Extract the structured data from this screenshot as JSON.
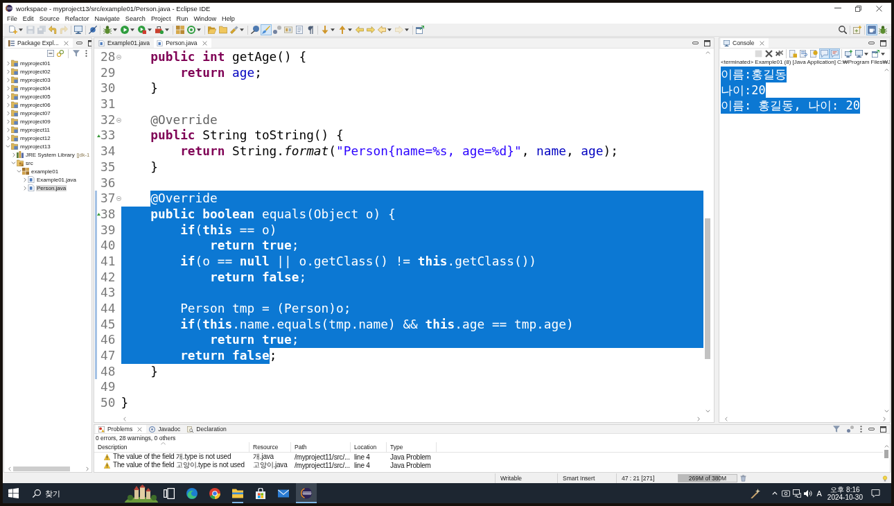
{
  "window": {
    "title": "workspace - myproject13/src/example01/Person.java - Eclipse IDE"
  },
  "menu": [
    "File",
    "Edit",
    "Source",
    "Refactor",
    "Navigate",
    "Search",
    "Project",
    "Run",
    "Window",
    "Help"
  ],
  "toolbar": [
    {
      "items": [
        {
          "kind": "new",
          "dropdown": true,
          "disabled": false,
          "pressed": false
        },
        {
          "kind": "save",
          "dropdown": false,
          "disabled": true,
          "pressed": false
        },
        {
          "kind": "saveall",
          "dropdown": false,
          "disabled": true,
          "pressed": false
        },
        {
          "kind": "undo",
          "dropdown": false,
          "disabled": false,
          "pressed": false
        },
        {
          "kind": "redo",
          "dropdown": false,
          "disabled": true,
          "pressed": false
        }
      ]
    },
    {
      "items": [
        {
          "kind": "terminal",
          "dropdown": false,
          "disabled": false,
          "pressed": false
        }
      ]
    },
    {
      "items": [
        {
          "kind": "skip",
          "dropdown": false,
          "disabled": false,
          "pressed": false
        }
      ]
    },
    {
      "items": [
        {
          "kind": "debug",
          "dropdown": true,
          "disabled": false,
          "pressed": false
        },
        {
          "kind": "run",
          "dropdown": true,
          "disabled": false,
          "pressed": false
        },
        {
          "kind": "coverage",
          "dropdown": true,
          "disabled": false,
          "pressed": false
        },
        {
          "kind": "tools",
          "dropdown": true,
          "disabled": false,
          "pressed": false
        }
      ]
    },
    {
      "items": [
        {
          "kind": "newpackage",
          "dropdown": false,
          "disabled": false,
          "pressed": false
        },
        {
          "kind": "newclass",
          "dropdown": true,
          "disabled": false,
          "pressed": false
        }
      ]
    },
    {
      "items": [
        {
          "kind": "opentype",
          "dropdown": false,
          "disabled": false,
          "pressed": false
        },
        {
          "kind": "openfolder",
          "dropdown": false,
          "disabled": false,
          "pressed": false
        },
        {
          "kind": "search",
          "dropdown": true,
          "disabled": false,
          "pressed": false
        }
      ]
    },
    {
      "items": [
        {
          "kind": "pin",
          "dropdown": false,
          "disabled": false,
          "pressed": false
        },
        {
          "kind": "mark",
          "dropdown": false,
          "disabled": false,
          "pressed": true
        },
        {
          "kind": "occurrences",
          "dropdown": false,
          "disabled": false,
          "pressed": false
        },
        {
          "kind": "blocks",
          "dropdown": false,
          "disabled": false,
          "pressed": false
        },
        {
          "kind": "doc",
          "dropdown": false,
          "disabled": false,
          "pressed": false
        },
        {
          "kind": "whitespace",
          "dropdown": false,
          "disabled": false,
          "pressed": false
        }
      ]
    },
    {
      "items": [
        {
          "kind": "nextann",
          "dropdown": true,
          "disabled": false,
          "pressed": false
        },
        {
          "kind": "prevann",
          "dropdown": true,
          "disabled": false,
          "pressed": false
        },
        {
          "kind": "lastedit",
          "dropdown": false,
          "disabled": false,
          "pressed": false
        },
        {
          "kind": "nextedit",
          "dropdown": false,
          "disabled": false,
          "pressed": false
        },
        {
          "kind": "back",
          "dropdown": true,
          "disabled": false,
          "pressed": false
        },
        {
          "kind": "forward",
          "dropdown": true,
          "disabled": true,
          "pressed": false
        }
      ]
    },
    {
      "items": [
        {
          "kind": "openview",
          "dropdown": false,
          "disabled": false,
          "pressed": false
        }
      ]
    }
  ],
  "perspectives": [
    {
      "items": [
        {
          "kind": "find",
          "dropdown": false,
          "disabled": false,
          "pressed": false
        }
      ]
    },
    {
      "items": [
        {
          "kind": "openperspective",
          "dropdown": false,
          "disabled": false,
          "pressed": false
        }
      ]
    },
    {
      "items": [
        {
          "kind": "javaperspective",
          "dropdown": false,
          "disabled": false,
          "pressed": true
        },
        {
          "kind": "debugperspective",
          "dropdown": false,
          "disabled": false,
          "pressed": false
        }
      ]
    }
  ],
  "package_explorer": {
    "tab": {
      "label": "Package Expl...",
      "selected": true
    },
    "tree": [
      {
        "label": "myproject01",
        "kind": "project",
        "expanded": false,
        "selected": false
      },
      {
        "label": "myproject02",
        "kind": "project",
        "expanded": false,
        "selected": false
      },
      {
        "label": "myproject03",
        "kind": "project",
        "expanded": false,
        "selected": false
      },
      {
        "label": "myproject04",
        "kind": "project",
        "expanded": false,
        "selected": false
      },
      {
        "label": "myproject05",
        "kind": "project",
        "expanded": false,
        "selected": false
      },
      {
        "label": "myproject06",
        "kind": "project",
        "expanded": false,
        "selected": false
      },
      {
        "label": "myproject07",
        "kind": "project",
        "expanded": false,
        "selected": false
      },
      {
        "label": "myproject09",
        "kind": "project",
        "expanded": false,
        "selected": false
      },
      {
        "label": "myproject11",
        "kind": "project",
        "expanded": false,
        "selected": false
      },
      {
        "label": "myproject12",
        "kind": "project",
        "expanded": false,
        "selected": false
      },
      {
        "label": "myproject13",
        "kind": "project",
        "expanded": true,
        "selected": false,
        "children": [
          {
            "label": "JRE System Library",
            "detail": "[jdk-1",
            "kind": "library",
            "expanded": false,
            "selected": false
          },
          {
            "label": "src",
            "kind": "source",
            "expanded": true,
            "selected": false,
            "children": [
              {
                "label": "example01",
                "kind": "package",
                "expanded": true,
                "selected": false,
                "children": [
                  {
                    "label": "Example01.java",
                    "kind": "file",
                    "expanded": false,
                    "selected": false
                  },
                  {
                    "label": "Person.java",
                    "kind": "file",
                    "expanded": false,
                    "selected": true
                  }
                ]
              }
            ]
          }
        ]
      }
    ]
  },
  "editor": {
    "tabs": [
      {
        "label": "Example01.java",
        "selected": false
      },
      {
        "label": "Person.java",
        "selected": true
      }
    ],
    "lines": [
      {
        "number": "28",
        "fold": true,
        "override": false,
        "range": false,
        "eol_selected": false,
        "tokens": [
          {
            "text": "    public",
            "kind": "keyword",
            "selected": false
          },
          {
            "text": " int",
            "kind": "keyword",
            "selected": false
          },
          {
            "text": " getAge() {",
            "kind": "plain",
            "selected": false
          }
        ]
      },
      {
        "number": "29",
        "fold": false,
        "override": false,
        "range": false,
        "eol_selected": false,
        "tokens": [
          {
            "text": "        return",
            "kind": "keyword",
            "selected": false
          },
          {
            "text": " age",
            "kind": "field",
            "selected": false
          },
          {
            "text": ";",
            "kind": "plain",
            "selected": false
          }
        ]
      },
      {
        "number": "30",
        "fold": false,
        "override": false,
        "range": false,
        "eol_selected": false,
        "tokens": [
          {
            "text": "    }",
            "kind": "plain",
            "selected": false
          }
        ]
      },
      {
        "number": "31",
        "fold": false,
        "override": false,
        "range": false,
        "eol_selected": false
      },
      {
        "number": "32",
        "fold": true,
        "override": false,
        "range": false,
        "eol_selected": false,
        "tokens": [
          {
            "text": "    @Override",
            "kind": "annotation",
            "selected": false
          }
        ]
      },
      {
        "number": "33",
        "fold": false,
        "override": true,
        "range": false,
        "eol_selected": false,
        "tokens": [
          {
            "text": "    public",
            "kind": "keyword",
            "selected": false
          },
          {
            "text": " String toString() {",
            "kind": "plain",
            "selected": false
          }
        ]
      },
      {
        "number": "34",
        "fold": false,
        "override": false,
        "range": false,
        "eol_selected": false,
        "tokens": [
          {
            "text": "        return",
            "kind": "keyword",
            "selected": false
          },
          {
            "text": " String.",
            "kind": "plain",
            "selected": false
          },
          {
            "text": "format",
            "kind": "italic",
            "selected": false
          },
          {
            "text": "(",
            "kind": "plain",
            "selected": false
          },
          {
            "text": "\"Person{name=%s, age=%d}\"",
            "kind": "string",
            "selected": false
          },
          {
            "text": ", ",
            "kind": "plain",
            "selected": false
          },
          {
            "text": "name",
            "kind": "field",
            "selected": false
          },
          {
            "text": ", ",
            "kind": "plain",
            "selected": false
          },
          {
            "text": "age",
            "kind": "field",
            "selected": false
          },
          {
            "text": ");",
            "kind": "plain",
            "selected": false
          }
        ]
      },
      {
        "number": "35",
        "fold": false,
        "override": false,
        "range": false,
        "eol_selected": false,
        "tokens": [
          {
            "text": "    }",
            "kind": "plain",
            "selected": false
          }
        ]
      },
      {
        "number": "36",
        "fold": false,
        "override": false,
        "range": false,
        "eol_selected": false
      },
      {
        "number": "37",
        "fold": true,
        "override": false,
        "range": true,
        "eol_selected": true,
        "tokens": [
          {
            "text": "    @Override",
            "kind": "annotation",
            "selected": true
          }
        ]
      },
      {
        "number": "38",
        "fold": false,
        "override": true,
        "range": true,
        "eol_selected": true,
        "tokens": [
          {
            "text": "    public",
            "kind": "keyword",
            "selected": true
          },
          {
            "text": " boolean",
            "kind": "keyword",
            "selected": true
          },
          {
            "text": " equals(Object o) {",
            "kind": "plain",
            "selected": true
          }
        ]
      },
      {
        "number": "39",
        "fold": false,
        "override": false,
        "range": true,
        "eol_selected": true,
        "tokens": [
          {
            "text": "        if",
            "kind": "keyword",
            "selected": true
          },
          {
            "text": "(",
            "kind": "plain",
            "selected": true
          },
          {
            "text": "this",
            "kind": "keyword",
            "selected": true
          },
          {
            "text": " == o)",
            "kind": "plain",
            "selected": true
          }
        ]
      },
      {
        "number": "40",
        "fold": false,
        "override": false,
        "range": true,
        "eol_selected": true,
        "tokens": [
          {
            "text": "            return",
            "kind": "keyword",
            "selected": true
          },
          {
            "text": " true",
            "kind": "keyword",
            "selected": true
          },
          {
            "text": ";",
            "kind": "plain",
            "selected": true
          }
        ]
      },
      {
        "number": "41",
        "fold": false,
        "override": false,
        "range": true,
        "eol_selected": true,
        "tokens": [
          {
            "text": "        if",
            "kind": "keyword",
            "selected": true
          },
          {
            "text": "(o == ",
            "kind": "plain",
            "selected": true
          },
          {
            "text": "null",
            "kind": "keyword",
            "selected": true
          },
          {
            "text": " || o.getClass() != ",
            "kind": "plain",
            "selected": true
          },
          {
            "text": "this",
            "kind": "keyword",
            "selected": true
          },
          {
            "text": ".getClass())",
            "kind": "plain",
            "selected": true
          }
        ]
      },
      {
        "number": "42",
        "fold": false,
        "override": false,
        "range": true,
        "eol_selected": true,
        "tokens": [
          {
            "text": "            return",
            "kind": "keyword",
            "selected": true
          },
          {
            "text": " false",
            "kind": "keyword",
            "selected": true
          },
          {
            "text": ";",
            "kind": "plain",
            "selected": true
          }
        ]
      },
      {
        "number": "43",
        "fold": false,
        "override": false,
        "range": true,
        "eol_selected": true
      },
      {
        "number": "44",
        "fold": false,
        "override": false,
        "range": true,
        "eol_selected": true,
        "tokens": [
          {
            "text": "        Person tmp = (Person)o;",
            "kind": "plain",
            "selected": true
          }
        ]
      },
      {
        "number": "45",
        "fold": false,
        "override": false,
        "range": true,
        "eol_selected": true,
        "tokens": [
          {
            "text": "        if",
            "kind": "keyword",
            "selected": true
          },
          {
            "text": "(",
            "kind": "plain",
            "selected": true
          },
          {
            "text": "this",
            "kind": "keyword",
            "selected": true
          },
          {
            "text": ".",
            "kind": "plain",
            "selected": true
          },
          {
            "text": "name",
            "kind": "field",
            "selected": true
          },
          {
            "text": ".equals(tmp.",
            "kind": "plain",
            "selected": true
          },
          {
            "text": "name",
            "kind": "field",
            "selected": true
          },
          {
            "text": ") && ",
            "kind": "plain",
            "selected": true
          },
          {
            "text": "this",
            "kind": "keyword",
            "selected": true
          },
          {
            "text": ".",
            "kind": "plain",
            "selected": true
          },
          {
            "text": "age",
            "kind": "field",
            "selected": true
          },
          {
            "text": " == tmp.",
            "kind": "plain",
            "selected": true
          },
          {
            "text": "age",
            "kind": "field",
            "selected": true
          },
          {
            "text": ")",
            "kind": "plain",
            "selected": true
          }
        ]
      },
      {
        "number": "46",
        "fold": false,
        "override": false,
        "range": true,
        "eol_selected": true,
        "tokens": [
          {
            "text": "            return",
            "kind": "keyword",
            "selected": true
          },
          {
            "text": " true",
            "kind": "keyword",
            "selected": true
          },
          {
            "text": ";",
            "kind": "plain",
            "selected": true
          }
        ]
      },
      {
        "number": "47",
        "fold": false,
        "override": false,
        "range": true,
        "eol_selected": false,
        "tokens": [
          {
            "text": "        return",
            "kind": "keyword",
            "selected": true
          },
          {
            "text": " false",
            "kind": "keyword",
            "selected": true
          },
          {
            "text": ";",
            "kind": "plain",
            "selected": false
          }
        ]
      },
      {
        "number": "48",
        "fold": false,
        "override": false,
        "range": true,
        "eol_selected": false,
        "tokens": [
          {
            "text": "    }",
            "kind": "plain",
            "selected": false
          }
        ]
      },
      {
        "number": "49",
        "fold": false,
        "override": false,
        "range": false,
        "eol_selected": false
      },
      {
        "number": "50",
        "fold": false,
        "override": false,
        "range": false,
        "eol_selected": false,
        "tokens": [
          {
            "text": "}",
            "kind": "plain",
            "selected": false
          }
        ]
      }
    ]
  },
  "console": {
    "tab": {
      "label": "Console",
      "selected": true
    },
    "toolbar": [
      {
        "items": [
          {
            "kind": "terminate",
            "dropdown": false,
            "disabled": true,
            "pressed": false
          },
          {
            "kind": "remove",
            "dropdown": false,
            "disabled": false,
            "pressed": false
          },
          {
            "kind": "removeall",
            "dropdown": false,
            "disabled": false,
            "pressed": false
          }
        ]
      },
      {
        "items": [
          {
            "kind": "scrolllock",
            "dropdown": false,
            "disabled": false,
            "pressed": false
          },
          {
            "kind": "wordwrap",
            "dropdown": false,
            "disabled": false,
            "pressed": false
          },
          {
            "kind": "pinconsole",
            "dropdown": false,
            "disabled": false,
            "pressed": false
          },
          {
            "kind": "stdout",
            "dropdown": false,
            "disabled": false,
            "pressed": true
          },
          {
            "kind": "stderr",
            "dropdown": false,
            "disabled": false,
            "pressed": true
          }
        ]
      },
      {
        "items": [
          {
            "kind": "newconsole",
            "dropdown": false,
            "disabled": false,
            "pressed": false
          },
          {
            "kind": "display",
            "dropdown": true,
            "disabled": false,
            "pressed": false
          },
          {
            "kind": "openconsole",
            "dropdown": true,
            "disabled": false,
            "pressed": false
          }
        ]
      }
    ],
    "status": "<terminated> Example01 (8) [Java Application] C:₩Program Files₩J",
    "lines": [
      {
        "text": "이름:홍길동",
        "selected": true
      },
      {
        "text": "나이:20",
        "selected": true
      },
      {
        "text": "이름: 홍길동, 나이: 20",
        "selected": true
      }
    ]
  },
  "problems": {
    "tabs": [
      {
        "label": "Problems",
        "kind": "problems",
        "selected": true
      },
      {
        "label": "Javadoc",
        "kind": "javadoc",
        "selected": false
      },
      {
        "label": "Declaration",
        "kind": "declaration",
        "selected": false
      }
    ],
    "summary": "0 errors, 28 warnings, 0 others",
    "columns": [
      "Description",
      "Resource",
      "Path",
      "Location",
      "Type"
    ],
    "rows": [
      {
        "cells": [
          "The value of the field 개.type is not used",
          "개.java",
          "/myproject11/src/...",
          "line 4",
          "Java Problem"
        ]
      },
      {
        "cells": [
          "The value of the field 고양이.type is not used",
          "고양이.java",
          "/myproject11/src/...",
          "line 4",
          "Java Problem"
        ]
      }
    ]
  },
  "status_bar": {
    "mode": "Writable",
    "insert_mode": "Smart Insert",
    "position": "47 : 21 [271]",
    "heap": {
      "text": "269M of 380M",
      "level": 0.71
    }
  },
  "taskbar": {
    "search": {
      "placeholder": "찾기"
    },
    "apps": [
      {
        "kind": "taskview",
        "running": false,
        "active": false
      },
      {
        "kind": "edge",
        "running": false,
        "active": false
      },
      {
        "kind": "chrome",
        "running": false,
        "active": false
      },
      {
        "kind": "explorer",
        "running": true,
        "active": false
      },
      {
        "kind": "store",
        "running": false,
        "active": false
      },
      {
        "kind": "mail",
        "running": false,
        "active": false
      },
      {
        "kind": "eclipse",
        "running": true,
        "active": true
      }
    ],
    "ime": "A",
    "time": "오후 8:16",
    "date": "2024-10-30"
  }
}
